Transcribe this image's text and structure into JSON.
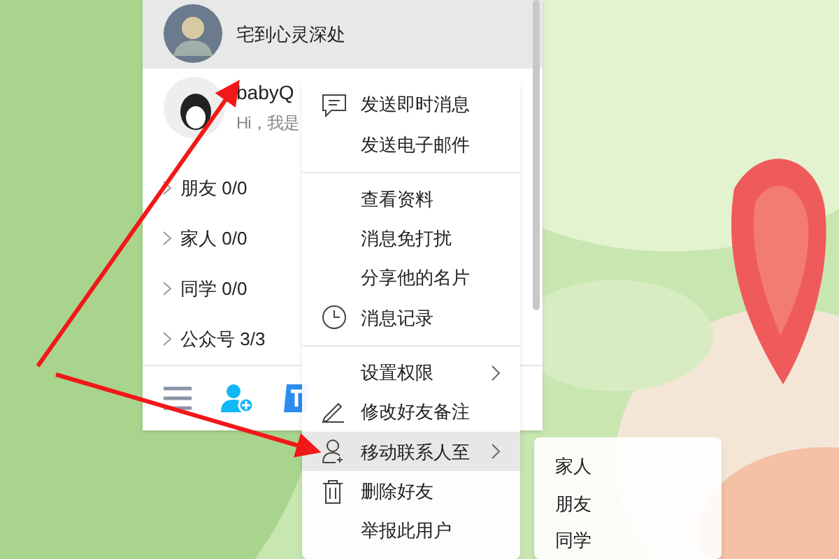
{
  "contact_panel": {
    "current_contact": {
      "name": "宅到心灵深处",
      "selected": true
    },
    "contacts": [
      {
        "name": "babyQ",
        "preview": "Hi，我是"
      }
    ],
    "groups": [
      {
        "name": "朋友",
        "count": "0/0"
      },
      {
        "name": "家人",
        "count": "0/0"
      },
      {
        "name": "同学",
        "count": "0/0"
      },
      {
        "name": "公众号",
        "count": "3/3"
      }
    ]
  },
  "context_menu": {
    "sections": [
      [
        {
          "label": "发送即时消息",
          "kind": "chat",
          "selected": false,
          "submenu": false
        },
        {
          "label": "发送电子邮件",
          "kind": "plain",
          "selected": false,
          "submenu": false
        }
      ],
      [
        {
          "label": "查看资料",
          "kind": "plain",
          "selected": false,
          "submenu": false
        },
        {
          "label": "消息免打扰",
          "kind": "plain",
          "selected": false,
          "submenu": false
        },
        {
          "label": "分享他的名片",
          "kind": "plain",
          "selected": false,
          "submenu": false
        },
        {
          "label": "消息记录",
          "kind": "clock",
          "selected": false,
          "submenu": false
        }
      ],
      [
        {
          "label": "设置权限",
          "kind": "plain",
          "selected": false,
          "submenu": true
        },
        {
          "label": "修改好友备注",
          "kind": "pencil",
          "selected": false,
          "submenu": false
        },
        {
          "label": "移动联系人至",
          "kind": "person",
          "selected": true,
          "submenu": true
        },
        {
          "label": "删除好友",
          "kind": "trash",
          "selected": false,
          "submenu": false
        },
        {
          "label": "举报此用户",
          "kind": "plain",
          "selected": false,
          "submenu": false
        }
      ]
    ]
  },
  "submenu": {
    "items": [
      {
        "label": "家人"
      },
      {
        "label": "朋友"
      },
      {
        "label": "同学"
      }
    ]
  }
}
